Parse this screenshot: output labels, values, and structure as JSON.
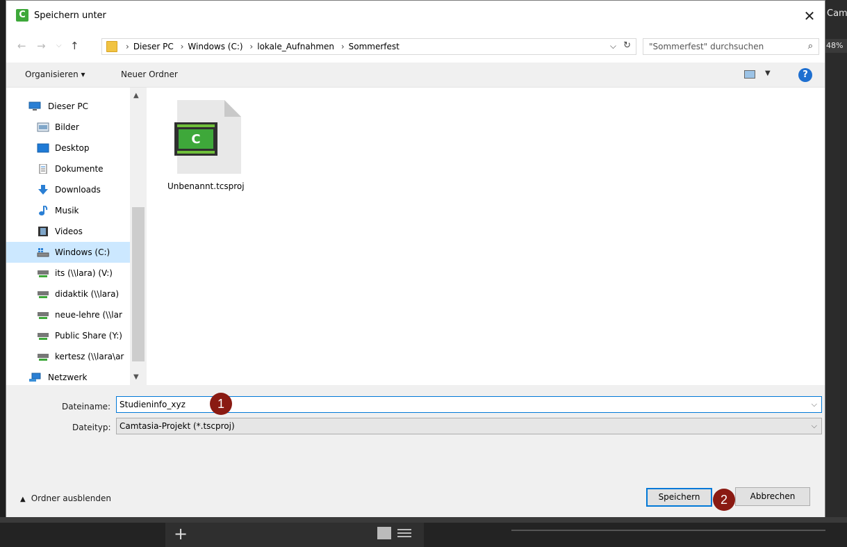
{
  "background": {
    "app_title": "Camtasia",
    "zoom": "48%"
  },
  "dialog": {
    "title": "Speichern unter",
    "close_label": "✕"
  },
  "navbar": {
    "breadcrumbs": [
      "Dieser PC",
      "Windows (C:)",
      "lokale_Aufnahmen",
      "Sommerfest"
    ],
    "search_placeholder": "\"Sommerfest\" durchsuchen"
  },
  "toolbar": {
    "organize_label": "Organisieren ▾",
    "new_folder_label": "Neuer Ordner",
    "help_label": "?"
  },
  "nav_pane": {
    "items": [
      {
        "label": "Dieser PC",
        "icon": "computer-icon"
      },
      {
        "label": "Bilder",
        "icon": "pictures-icon"
      },
      {
        "label": "Desktop",
        "icon": "desktop-icon"
      },
      {
        "label": "Dokumente",
        "icon": "documents-icon"
      },
      {
        "label": "Downloads",
        "icon": "download-icon"
      },
      {
        "label": "Musik",
        "icon": "music-icon"
      },
      {
        "label": "Videos",
        "icon": "videos-icon"
      },
      {
        "label": "Windows (C:)",
        "icon": "drive-icon"
      },
      {
        "label": "its (\\\\lara) (V:)",
        "icon": "network-drive-icon"
      },
      {
        "label": "didaktik (\\\\lara)",
        "icon": "network-drive-icon"
      },
      {
        "label": "neue-lehre (\\\\lar",
        "icon": "network-drive-icon"
      },
      {
        "label": "Public Share (Y:)",
        "icon": "network-drive-icon"
      },
      {
        "label": "kertesz (\\\\lara\\ar",
        "icon": "network-drive-icon"
      },
      {
        "label": "Netzwerk",
        "icon": "network-icon"
      }
    ],
    "selected_index": 7
  },
  "files": [
    {
      "name": "Unbenannt.tcsproj",
      "icon": "camtasia-project-icon"
    }
  ],
  "form": {
    "filename_label": "Dateiname:",
    "filename_value": "Studieninfo_xyz",
    "filetype_label": "Dateityp:",
    "filetype_value": "Camtasia-Projekt (*.tscproj)",
    "hide_folders_label": "Ordner ausblenden",
    "save_label": "Speichern",
    "cancel_label": "Abbrechen"
  },
  "markers": {
    "step1": "1",
    "step2": "2"
  },
  "colors": {
    "accent": "#0078d7",
    "marker": "#8a1a12",
    "camtasia_green": "#3ea83a",
    "selection": "#cce8ff"
  }
}
